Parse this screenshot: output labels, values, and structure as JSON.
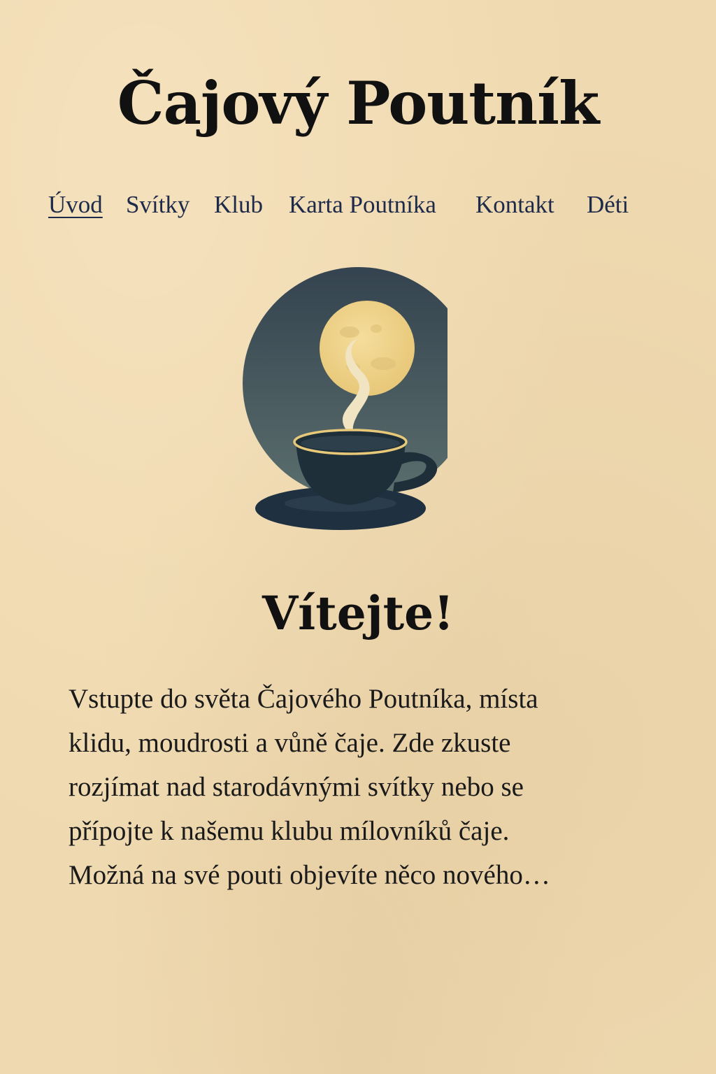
{
  "site": {
    "title": "Čajový Poutník"
  },
  "nav": {
    "items": [
      {
        "label": "Úvod",
        "active": true
      },
      {
        "label": "Svítky",
        "active": false
      },
      {
        "label": "Klub",
        "active": false
      },
      {
        "label": "Karta Poutníka",
        "active": false
      },
      {
        "label": "Kontakt",
        "active": false
      },
      {
        "label": "Déti",
        "active": false
      }
    ]
  },
  "hero": {
    "icon": "teacup-moon-illustration"
  },
  "welcome": {
    "heading": "Vítejte!",
    "lines": [
      "Vstupte do světa Čajového Poutníka, místa",
      "klidu, moudrosti a vůně čaje. Zde zkuste",
      "rozjímat nad starodávnými svítky nebo se",
      "přípojte k našemu klubu mílovníků čaje.",
      "Možná na své pouti objevíte něco nového…"
    ]
  },
  "colors": {
    "background": "#efd9b0",
    "nav_link": "#1e2a4a",
    "night_sky": "#3a4a56",
    "moon": "#efd48e",
    "cup": "#1e2f3a",
    "steam": "#f1e4c2"
  }
}
